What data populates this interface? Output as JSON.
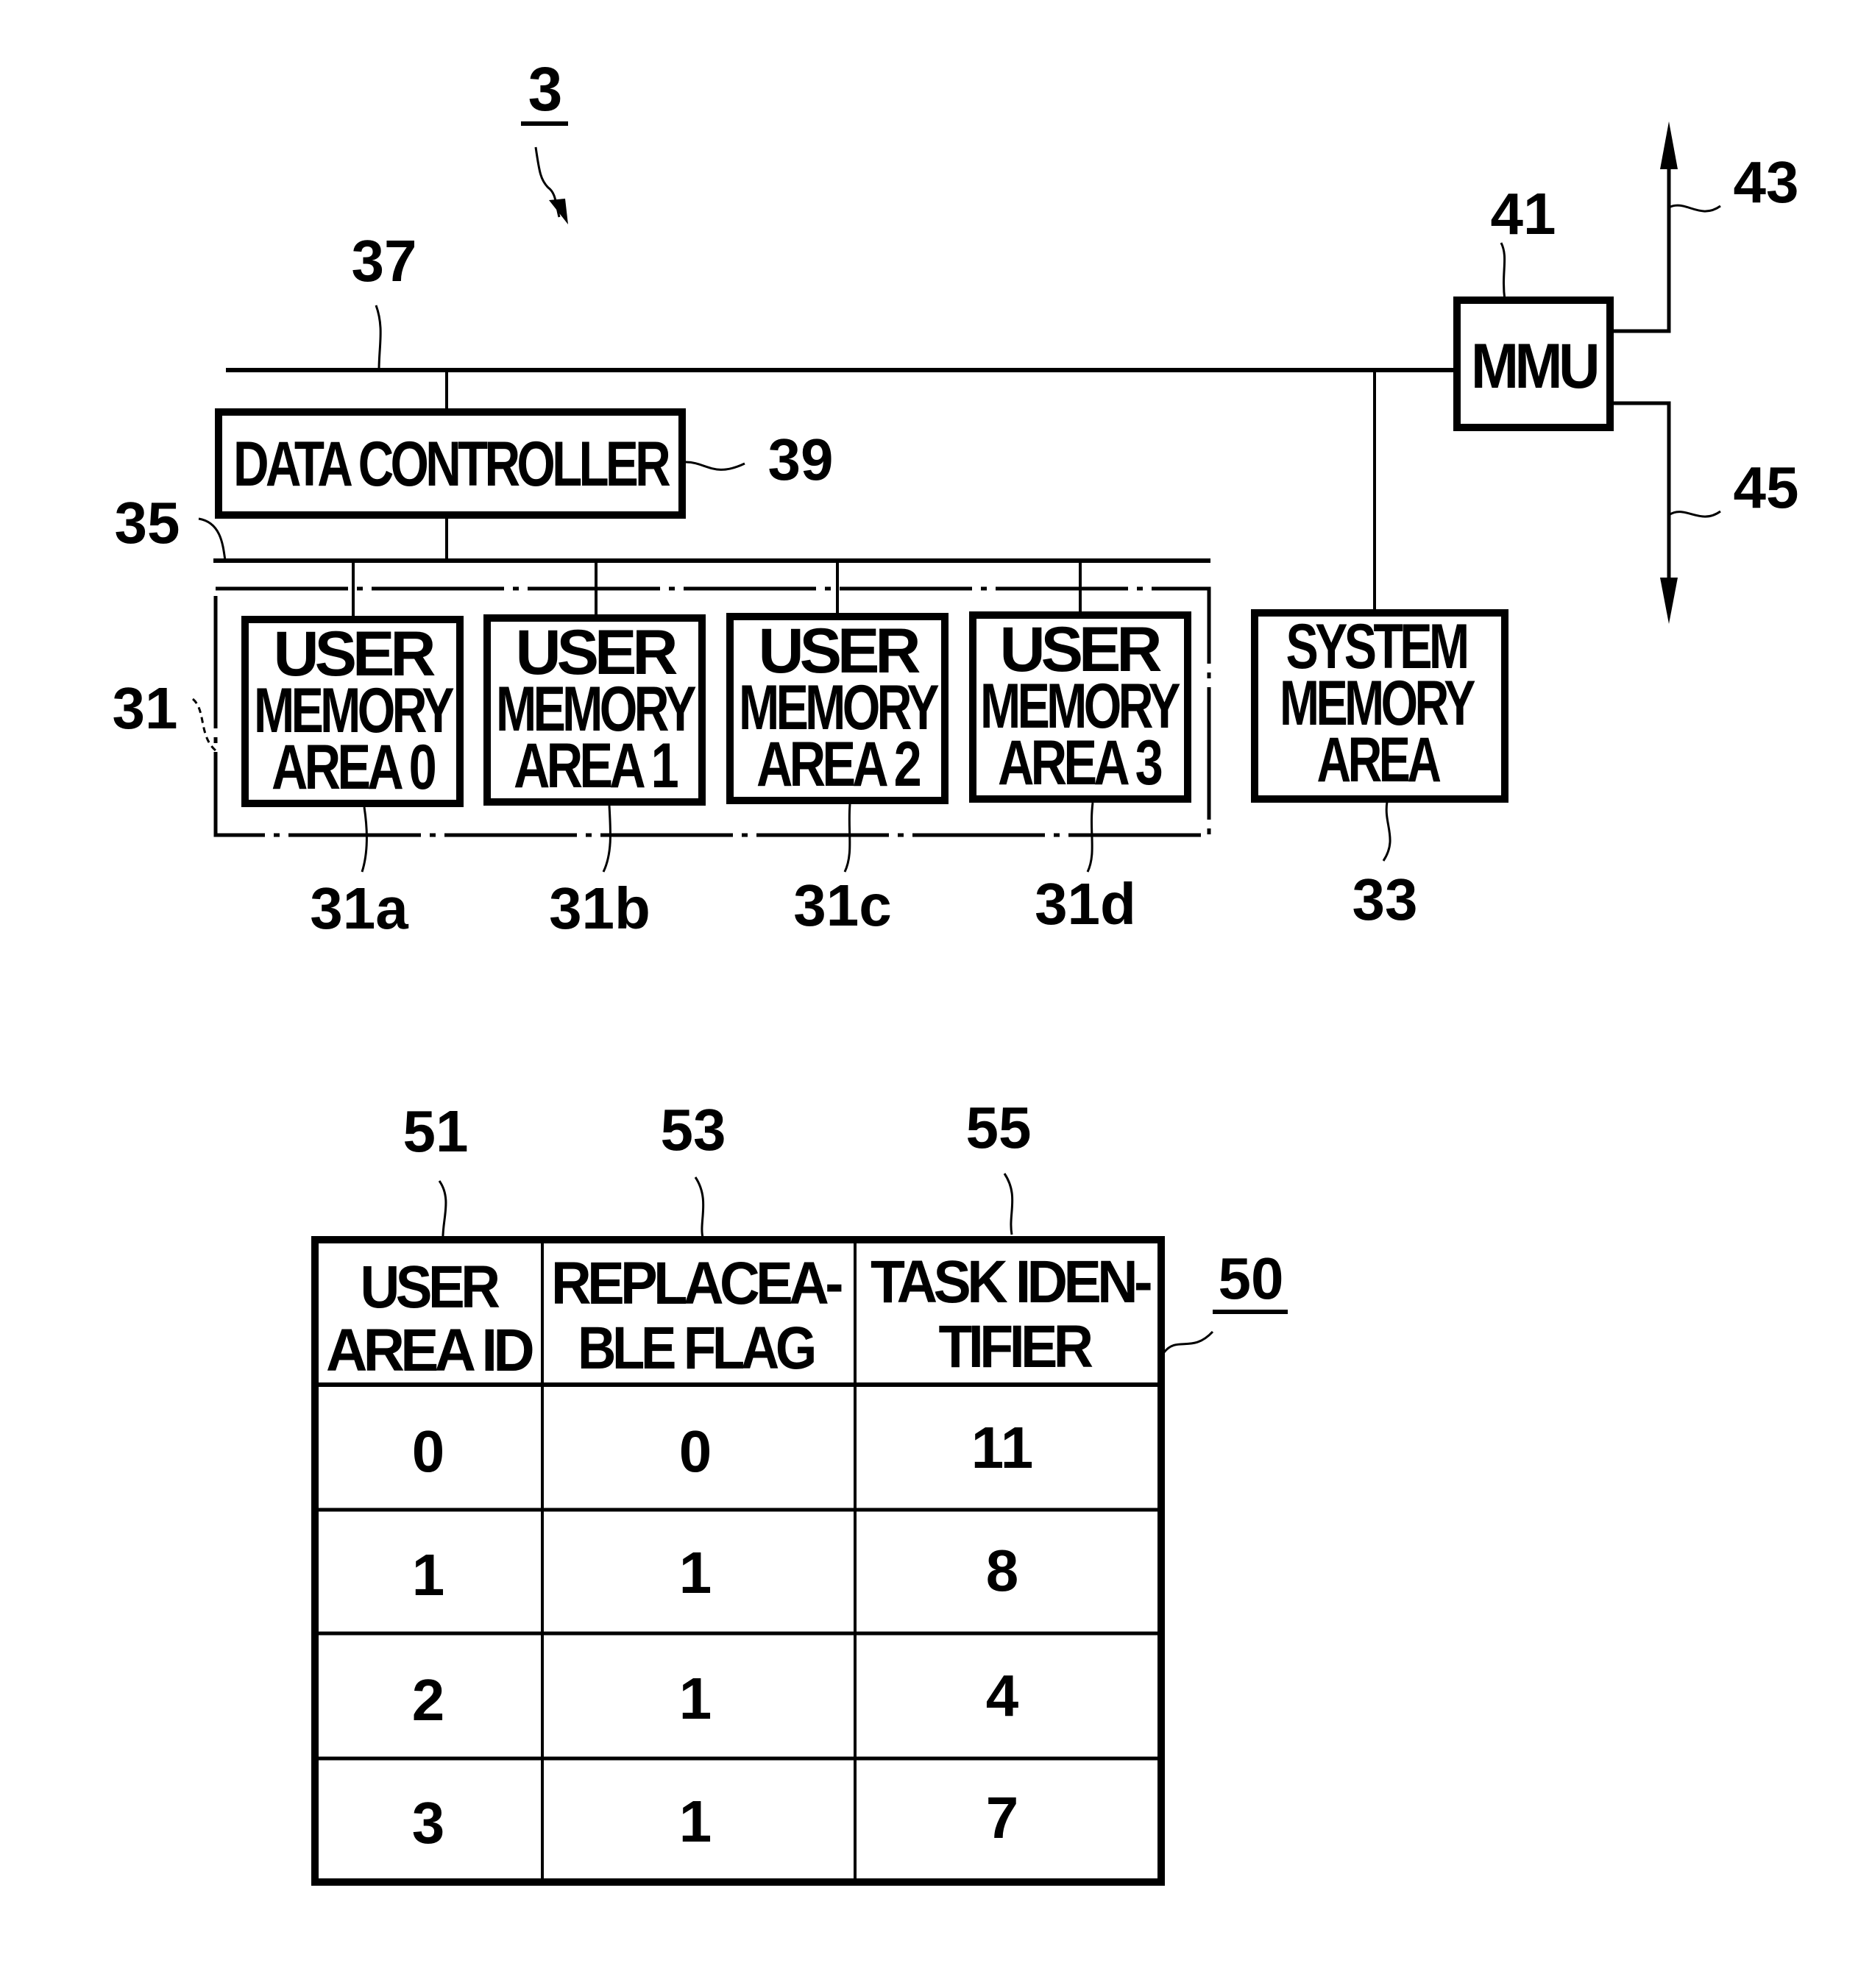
{
  "figure": {
    "ref_main": "3",
    "bus_system_ref": "37",
    "bus_local_ref": "35",
    "data_controller": {
      "label": "DATA CONTROLLER",
      "ref": "39"
    },
    "mmu": {
      "label": "MMU",
      "ref": "41",
      "out_up_ref": "43",
      "out_down_ref": "45"
    },
    "user_memory_group_ref": "31",
    "user_memory_areas": [
      {
        "lines": [
          "USER",
          "MEMORY",
          "AREA 0"
        ],
        "ref": "31a"
      },
      {
        "lines": [
          "USER",
          "MEMORY",
          "AREA 1"
        ],
        "ref": "31b"
      },
      {
        "lines": [
          "USER",
          "MEMORY",
          "AREA 2"
        ],
        "ref": "31c"
      },
      {
        "lines": [
          "USER",
          "MEMORY",
          "AREA 3"
        ],
        "ref": "31d"
      }
    ],
    "system_memory_area": {
      "lines": [
        "SYSTEM",
        "MEMORY",
        "AREA"
      ],
      "ref": "33"
    }
  },
  "table": {
    "ref": "50",
    "columns": [
      {
        "ref": "51",
        "header": [
          "USER",
          "AREA ID"
        ]
      },
      {
        "ref": "53",
        "header": [
          "REPLACEA-",
          "BLE FLAG"
        ]
      },
      {
        "ref": "55",
        "header": [
          "TASK IDEN-",
          "TIFIER"
        ]
      }
    ],
    "rows": [
      [
        "0",
        "0",
        "11"
      ],
      [
        "1",
        "1",
        "8"
      ],
      [
        "2",
        "1",
        "4"
      ],
      [
        "3",
        "1",
        "7"
      ]
    ]
  }
}
